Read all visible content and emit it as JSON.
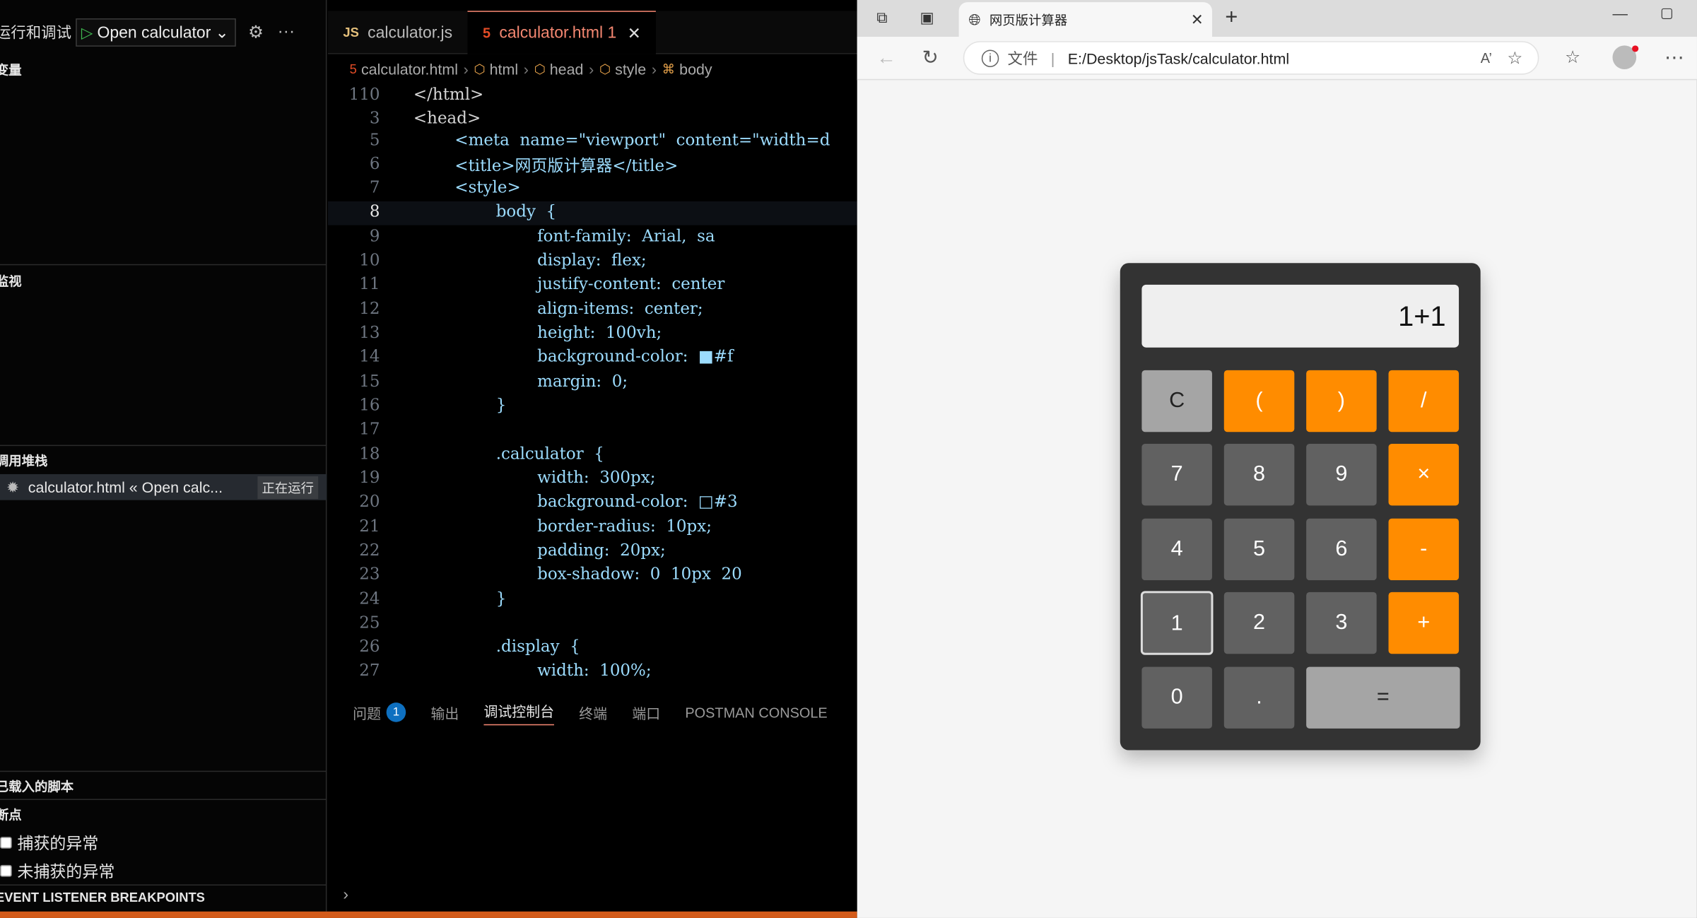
{
  "debug": {
    "run_title": "运行和调试",
    "config_name": "Open calculator",
    "sections": {
      "variables": "变量",
      "watch": "监视",
      "call_stack": "调用堆栈",
      "loaded_scripts": "已载入的脚本",
      "breakpoints": "断点",
      "event_breakpoints": "EVENT LISTENER BREAKPOINTS"
    },
    "stack_item": "calculator.html « Open calc...",
    "stack_status": "正在运行",
    "bp_caught": "捕获的异常",
    "bp_uncaught": "未捕获的异常"
  },
  "editor": {
    "tabs": [
      {
        "icon": "JS",
        "label": "calculator.js"
      },
      {
        "icon": "5",
        "label": "calculator.html 1"
      }
    ],
    "breadcrumb": [
      "calculator.html",
      "html",
      "head",
      "style",
      "body"
    ],
    "lines": [
      {
        "n": "110",
        "t": "</html>"
      },
      {
        "n": "3",
        "t": "<head>"
      },
      {
        "n": "5",
        "t": "        <meta  name=\"viewport\"  content=\"width=d"
      },
      {
        "n": "6",
        "t": "        <title>网页版计算器</title>"
      },
      {
        "n": "7",
        "t": "        <style>"
      },
      {
        "n": "8",
        "t": "                body  {"
      },
      {
        "n": "9",
        "t": "                        font-family:  Arial,  sa"
      },
      {
        "n": "10",
        "t": "                        display:  flex;"
      },
      {
        "n": "11",
        "t": "                        justify-content:  center"
      },
      {
        "n": "12",
        "t": "                        align-items:  center;"
      },
      {
        "n": "13",
        "t": "                        height:  100vh;"
      },
      {
        "n": "14",
        "t": "                        background-color:  ■#f"
      },
      {
        "n": "15",
        "t": "                        margin:  0;"
      },
      {
        "n": "16",
        "t": "                }"
      },
      {
        "n": "17",
        "t": ""
      },
      {
        "n": "18",
        "t": "                .calculator  {"
      },
      {
        "n": "19",
        "t": "                        width:  300px;"
      },
      {
        "n": "20",
        "t": "                        background-color:  □#3"
      },
      {
        "n": "21",
        "t": "                        border-radius:  10px;"
      },
      {
        "n": "22",
        "t": "                        padding:  20px;"
      },
      {
        "n": "23",
        "t": "                        box-shadow:  0  10px  20"
      },
      {
        "n": "24",
        "t": "                }"
      },
      {
        "n": "25",
        "t": ""
      },
      {
        "n": "26",
        "t": "                .display  {"
      },
      {
        "n": "27",
        "t": "                        width:  100%;"
      }
    ],
    "panel_tabs": [
      "问题",
      "输出",
      "调试控制台",
      "终端",
      "端口",
      "POSTMAN CONSOLE"
    ],
    "problems_count": "1",
    "console_prompt": "›"
  },
  "browser": {
    "tab_title": "网页版计算器",
    "scheme_label": "文件",
    "url": "E:/Desktop/jsTask/calculator.html",
    "read_aloud": "A’"
  },
  "calculator": {
    "display": "1+1",
    "keys": [
      "C",
      "(",
      ")",
      "/",
      "7",
      "8",
      "9",
      "×",
      "4",
      "5",
      "6",
      "-",
      "1",
      "2",
      "3",
      "+",
      "0",
      ".",
      "="
    ]
  }
}
